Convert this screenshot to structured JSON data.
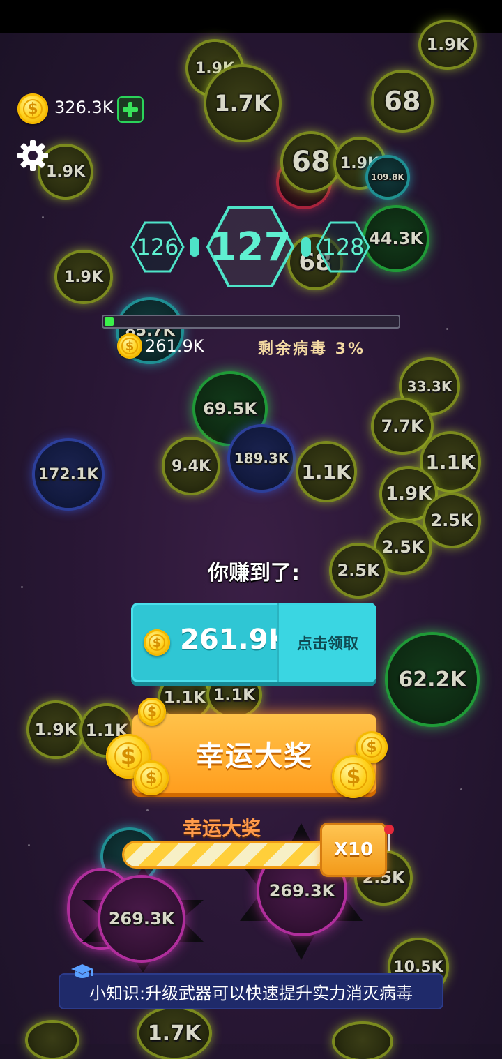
{
  "hud": {
    "coins": "326.3K",
    "add_icon": "plus-icon",
    "settings_icon": "gear-icon"
  },
  "levels": {
    "previous": "126",
    "current": "127",
    "next": "128"
  },
  "progress": {
    "fraction": 0.03,
    "reward": "261.9K",
    "remaining_label": "剩余病毒 3%"
  },
  "viruses": [
    {
      "label": "1.9K"
    },
    {
      "label": "1.7K"
    },
    {
      "label": "1.9K"
    },
    {
      "label": "68"
    },
    {
      "label": "1.9K"
    },
    {
      "label": "68"
    },
    {
      "label": "1.9K"
    },
    {
      "label": "109.8K"
    },
    {
      "label": "44.3K"
    },
    {
      "label": "1.9K"
    },
    {
      "label": "85.7K"
    },
    {
      "label": "69.5K"
    },
    {
      "label": "33.3K"
    },
    {
      "label": "7.7K"
    },
    {
      "label": "172.1K"
    },
    {
      "label": "9.4K"
    },
    {
      "label": "189.3K"
    },
    {
      "label": "1.1K"
    },
    {
      "label": "1.1K"
    },
    {
      "label": "1.9K"
    },
    {
      "label": "2.5K"
    },
    {
      "label": "2.5K"
    },
    {
      "label": "2.5K"
    },
    {
      "label": "62.2K"
    },
    {
      "label": "1.9K"
    },
    {
      "label": "1.1K"
    },
    {
      "label": "1.1K"
    },
    {
      "label": "1.1K"
    },
    {
      "label": "269.3K"
    },
    {
      "label": "269.3K"
    },
    {
      "label": "2.5K"
    },
    {
      "label": "10.5K"
    },
    {
      "label": "1.7K"
    },
    {
      "label": "68"
    }
  ],
  "reward_panel": {
    "title": "你赚到了:",
    "amount": "261.9K",
    "claim_label": "点击领取"
  },
  "lucky": {
    "button_label": "幸运大奖",
    "bar_title": "幸运大奖",
    "multiplier": "X10"
  },
  "tip": {
    "text": "小知识:升级武器可以快速提升实力消灭病毒",
    "icon": "graduation-cap-icon"
  }
}
